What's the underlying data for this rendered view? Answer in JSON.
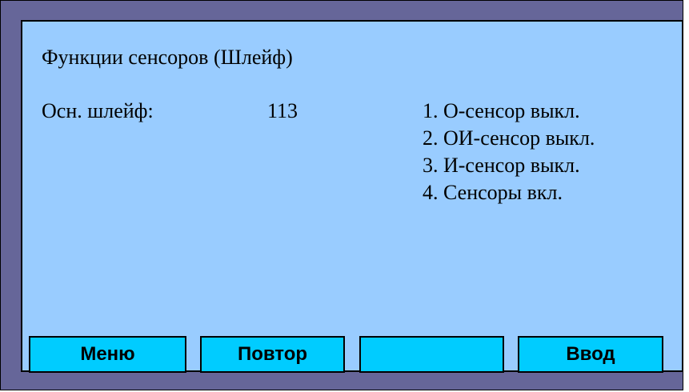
{
  "screen": {
    "title": "Функции сенсоров (Шлейф)",
    "loop_label": "Осн. шлейф:",
    "loop_value": "113",
    "options": [
      "1. О-сенсор выкл.",
      "2. ОИ-сенсор выкл.",
      "3. И-сенсор выкл.",
      "4. Сенсоры вкл."
    ]
  },
  "buttons": {
    "menu": "Меню",
    "repeat": "Повтор",
    "blank": "",
    "enter": "Ввод"
  },
  "colors": {
    "frame": "#666699",
    "screen": "#99ccff",
    "button": "#00ccff"
  }
}
